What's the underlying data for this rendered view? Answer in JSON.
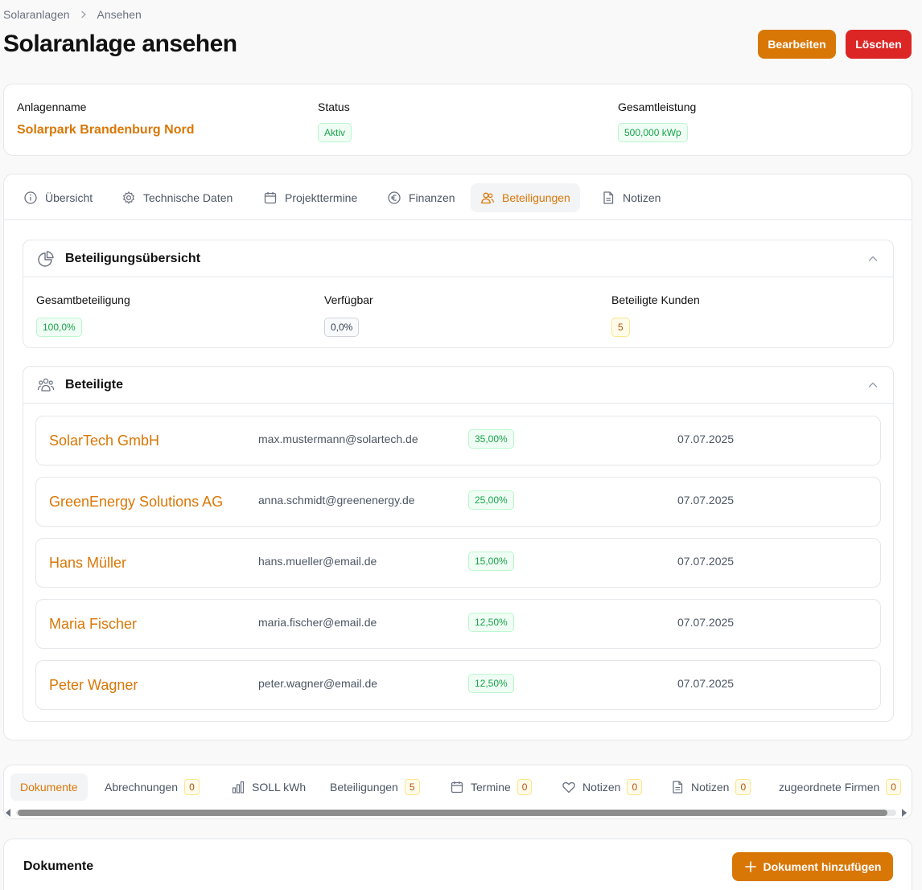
{
  "breadcrumb": {
    "parent": "Solaranlagen",
    "current": "Ansehen"
  },
  "page": {
    "title": "Solaranlage ansehen"
  },
  "actions": {
    "edit_label": "Bearbeiten",
    "delete_label": "Löschen"
  },
  "info": {
    "name_label": "Anlagenname",
    "name_value": "Solarpark Brandenburg Nord",
    "status_label": "Status",
    "status_value": "Aktiv",
    "power_label": "Gesamtleistung",
    "power_value": "500,000 kWp"
  },
  "tabs": [
    {
      "label": "Übersicht",
      "icon": "info-icon"
    },
    {
      "label": "Technische Daten",
      "icon": "gear-icon"
    },
    {
      "label": "Projekttermine",
      "icon": "calendar-icon"
    },
    {
      "label": "Finanzen",
      "icon": "euro-icon"
    },
    {
      "label": "Beteiligungen",
      "icon": "users-icon",
      "active": true
    },
    {
      "label": "Notizen",
      "icon": "document-icon"
    }
  ],
  "overview": {
    "title": "Beteiligungsübersicht",
    "total_label": "Gesamtbeteiligung",
    "total_value": "100,0%",
    "available_label": "Verfügbar",
    "available_value": "0,0%",
    "customers_label": "Beteiligte Kunden",
    "customers_value": "5"
  },
  "participants": {
    "title": "Beteiligte",
    "rows": [
      {
        "name": "SolarTech GmbH",
        "email": "max.mustermann@solartech.de",
        "share": "35,00%",
        "date": "07.07.2025"
      },
      {
        "name": "GreenEnergy Solutions AG",
        "email": "anna.schmidt@greenenergy.de",
        "share": "25,00%",
        "date": "07.07.2025"
      },
      {
        "name": "Hans Müller",
        "email": "hans.mueller@email.de",
        "share": "15,00%",
        "date": "07.07.2025"
      },
      {
        "name": "Maria Fischer",
        "email": "maria.fischer@email.de",
        "share": "12,50%",
        "date": "07.07.2025"
      },
      {
        "name": "Peter Wagner",
        "email": "peter.wagner@email.de",
        "share": "12,50%",
        "date": "07.07.2025"
      }
    ]
  },
  "subtabs": [
    {
      "label": "Dokumente",
      "active": true
    },
    {
      "label": "Abrechnungen",
      "count": "0"
    },
    {
      "label": "SOLL kWh",
      "icon": "bar-chart-icon"
    },
    {
      "label": "Beteiligungen",
      "count": "5"
    },
    {
      "label": "Termine",
      "icon": "calendar-icon",
      "count": "0"
    },
    {
      "label": "Notizen",
      "icon": "heart-icon",
      "count": "0"
    },
    {
      "label": "Notizen",
      "icon": "document-icon",
      "count": "0"
    },
    {
      "label": "zugeordnete Firmen",
      "count": "0"
    }
  ],
  "documents": {
    "title": "Dokumente",
    "add_label": "Dokument hinzufügen"
  }
}
